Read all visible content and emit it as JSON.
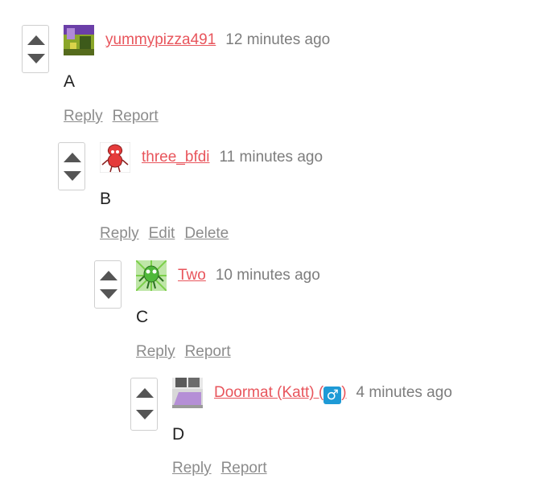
{
  "comments": [
    {
      "username": "yummypizza491",
      "time": "12 minutes ago",
      "body": "A",
      "actions": [
        "Reply",
        "Report"
      ]
    },
    {
      "username": "three_bfdi",
      "time": "11 minutes ago",
      "body": "B",
      "actions": [
        "Reply",
        "Edit",
        "Delete"
      ]
    },
    {
      "username": "Two",
      "time": "10 minutes ago",
      "body": "C",
      "actions": [
        "Reply",
        "Report"
      ]
    },
    {
      "username": "Doormat (Katt) (",
      "username_suffix": ")",
      "gender_symbol": "♂",
      "time": "4 minutes ago",
      "body": "D",
      "actions": [
        "Reply",
        "Report"
      ]
    }
  ]
}
